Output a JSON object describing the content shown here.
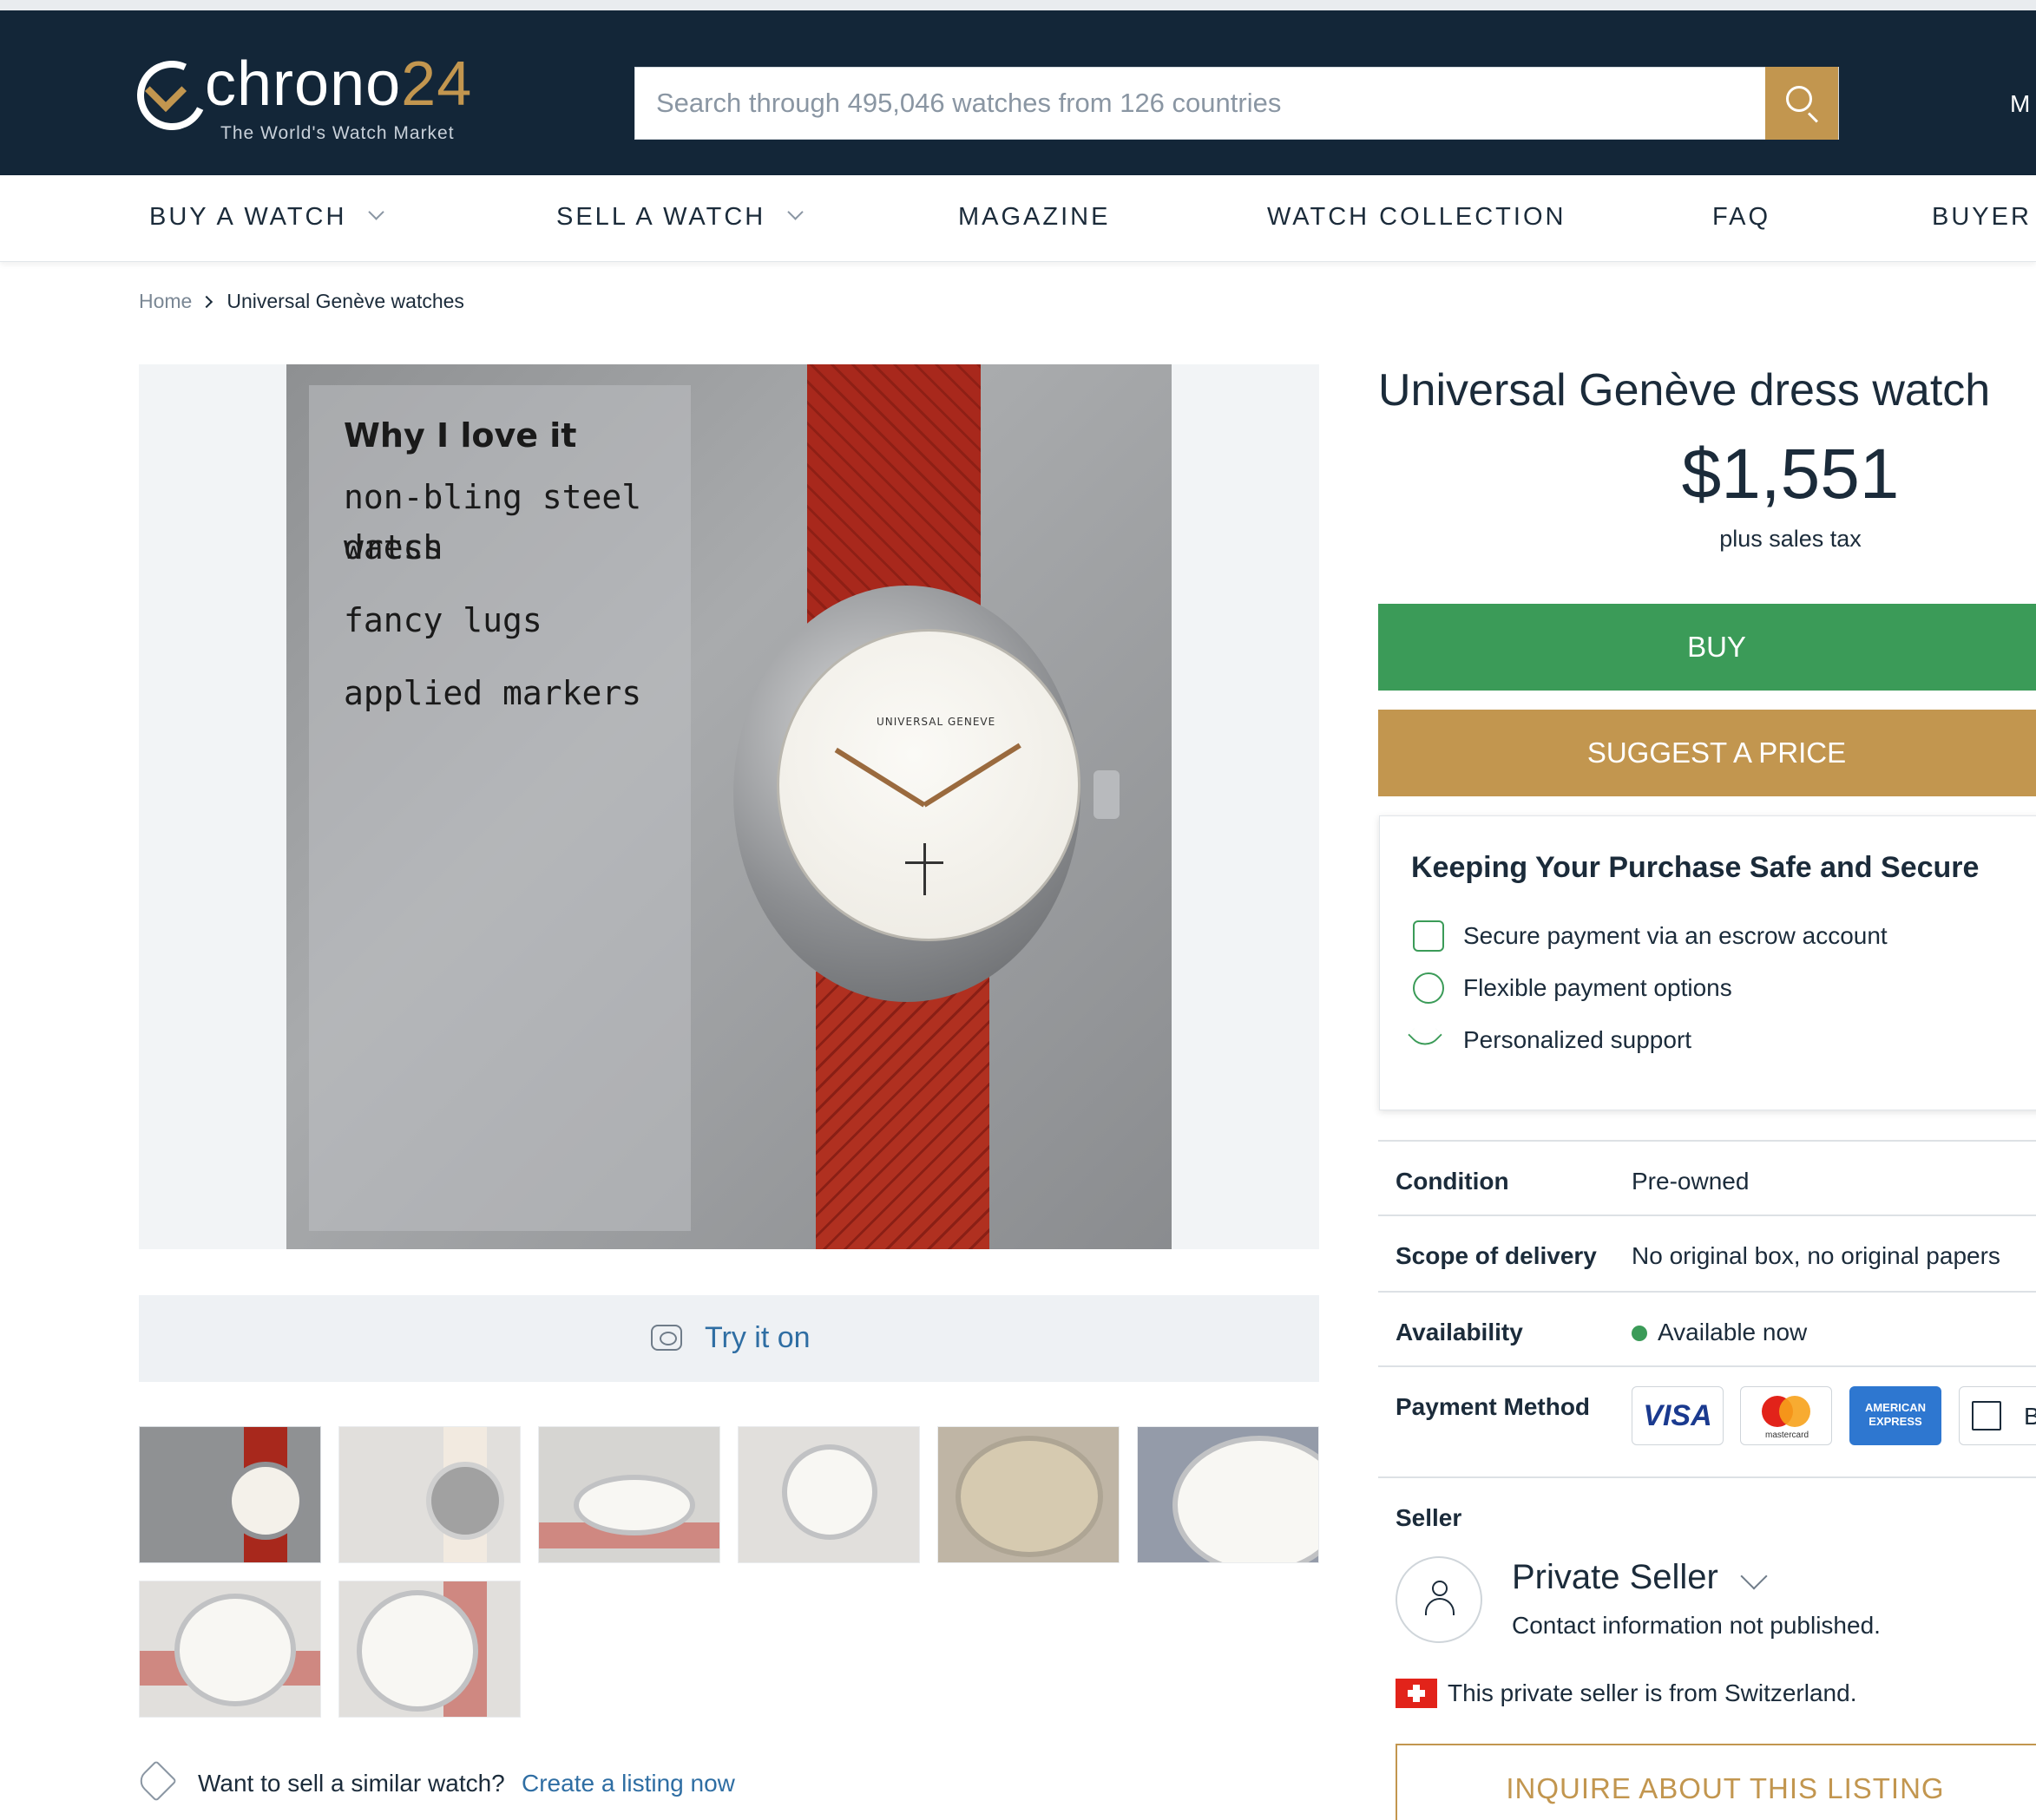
{
  "header": {
    "logo_word": "chrono",
    "logo_number": "24",
    "logo_tagline": "The World's Watch Market",
    "search_placeholder": "Search through 495,046 watches from 126 countries",
    "more_label": "M",
    "accent_color": "#c2964f",
    "background_color": "#132638"
  },
  "nav": {
    "items": [
      {
        "label": "BUY A WATCH",
        "has_dropdown": true
      },
      {
        "label": "SELL A WATCH",
        "has_dropdown": true
      },
      {
        "label": "MAGAZINE",
        "has_dropdown": false
      },
      {
        "label": "WATCH COLLECTION",
        "has_dropdown": false
      },
      {
        "label": "FAQ",
        "has_dropdown": false
      },
      {
        "label": "BUYER P",
        "has_dropdown": false
      }
    ]
  },
  "breadcrumb": {
    "home": "Home",
    "current": "Universal Genève watches"
  },
  "gallery": {
    "main_image": {
      "overlay_title": "Why I love it",
      "overlay_lines": [
        "non-bling steel dress",
        "watch",
        "fancy lugs",
        "applied markers"
      ],
      "dial_brand": "UNIVERSAL GENEVE"
    },
    "try_on_label": "Try it on",
    "thumbnail_count": 8
  },
  "sell_prompt": {
    "question": "Want to sell a similar watch?",
    "link": "Create a listing now"
  },
  "listing": {
    "title": "Universal Genève dress watch",
    "price": "$1,551",
    "price_note": "plus sales tax",
    "buy_label": "BUY",
    "suggest_label": "SUGGEST A PRICE",
    "buy_color": "#3b9b58"
  },
  "secure_box": {
    "heading": "Keeping Your Purchase Safe and Secure",
    "items": [
      {
        "icon": "safe-icon",
        "label": "Secure payment via an escrow account"
      },
      {
        "icon": "hand-coins-icon",
        "label": "Flexible payment options"
      },
      {
        "icon": "phone-icon",
        "label": "Personalized support"
      }
    ]
  },
  "specs": {
    "condition": {
      "label": "Condition",
      "value": "Pre-owned"
    },
    "delivery": {
      "label": "Scope of delivery",
      "value": "No original box, no original papers"
    },
    "availability": {
      "label": "Availability",
      "value": "Available now"
    },
    "payment": {
      "label": "Payment Method",
      "methods": [
        "VISA",
        "mastercard",
        "AMERICAN EXPRESS",
        "B"
      ]
    }
  },
  "seller": {
    "label": "Seller",
    "name": "Private Seller",
    "contact": "Contact information not published.",
    "country_note": "This private seller is from Switzerland.",
    "inquire_label": "INQUIRE ABOUT THIS LISTING"
  }
}
